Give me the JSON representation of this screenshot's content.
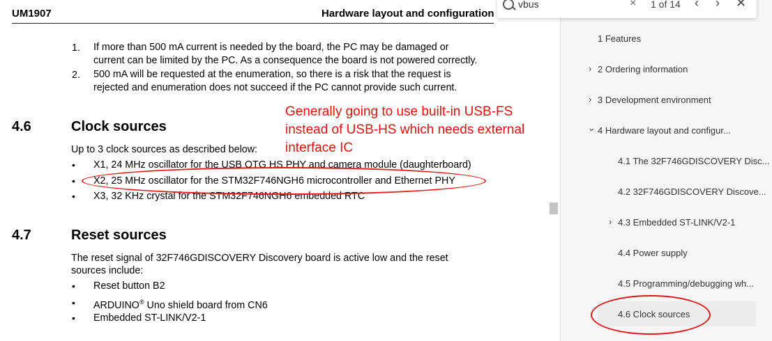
{
  "header": {
    "doc_id": "UM1907",
    "section_title": "Hardware layout and configuration"
  },
  "notes": [
    {
      "num": "1.",
      "lines": [
        "If more than 500 mA current is needed by the board, the PC may be damaged or",
        "current can be limited by the PC. As a consequence the board is not powered correctly."
      ]
    },
    {
      "num": "2.",
      "lines": [
        "500 mA will be requested at the enumeration, so there is a risk that the request is",
        "rejected and enumeration does not succeed if the PC cannot provide such current."
      ]
    }
  ],
  "section_46": {
    "num": "4.6",
    "title": "Clock sources",
    "intro": "Up to 3 clock sources as described below:",
    "bullets": [
      "X1, 24 MHz oscillator for the USB OTG HS PHY and camera module (daughterboard)",
      "X2, 25 MHz oscillator for the STM32F746NGH6 microcontroller and Ethernet PHY",
      "X3, 32 KHz crystal for the STM32F746NGH6 embedded RTC"
    ]
  },
  "section_47": {
    "num": "4.7",
    "title": "Reset sources",
    "intro_lines": [
      "The reset signal of 32F746GDISCOVERY Discovery board is active low and the reset",
      "sources include:"
    ],
    "bullets": [
      "Reset button B2",
      "ARDUINO",
      "Embedded ST-LINK/V2-1"
    ],
    "arduino_sup": "®",
    "arduino_rest": " Uno shield board from CN6"
  },
  "bullet_glyph": "•",
  "annotation": {
    "text": "Generally going to use built-in USB-FS\ninstead of USB-HS which needs external\ninterface IC",
    "color": "#e01010"
  },
  "search": {
    "value": "vbus",
    "count": "1 of 14",
    "clear_glyph": "×",
    "prev_glyph": "‹",
    "next_glyph": "›",
    "close_glyph": "✕"
  },
  "bookmarks": {
    "chevron_right": "›",
    "chevron_down": "⌄",
    "items": [
      {
        "label": "1 Features"
      },
      {
        "label": "2 Ordering information"
      },
      {
        "label": "3 Development environment"
      },
      {
        "label": "4 Hardware layout and configur..."
      },
      {
        "label": "4.1 The 32F746GDISCOVERY Disc..."
      },
      {
        "label": "4.2 32F746GDISCOVERY Discove..."
      },
      {
        "label": "4.3 Embedded ST-LINK/V2-1"
      },
      {
        "label": "4.4 Power supply"
      },
      {
        "label": "4.5 Programming/debugging wh..."
      },
      {
        "label": "4.6 Clock sources"
      }
    ]
  }
}
